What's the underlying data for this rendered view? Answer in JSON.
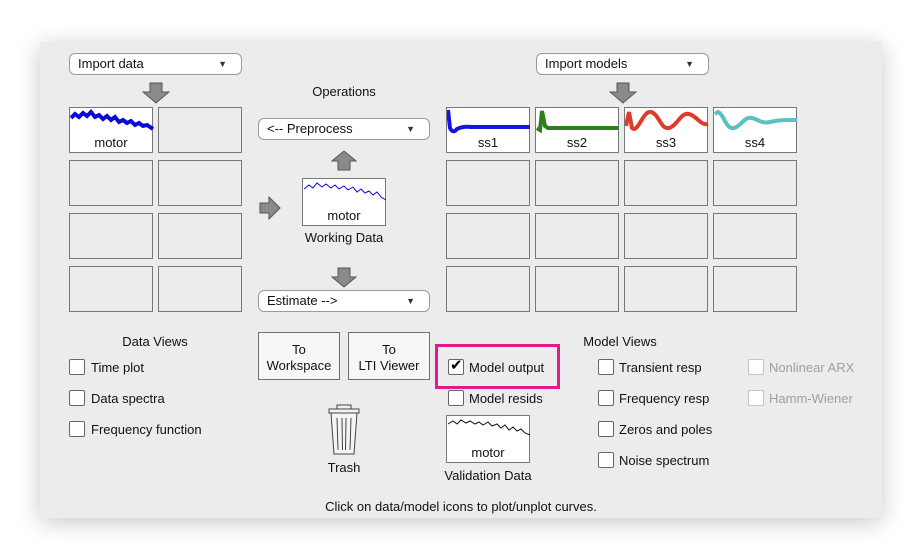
{
  "data_panel": {
    "import_label": "Import data",
    "slot1_label": "motor"
  },
  "operations": {
    "title": "Operations",
    "preprocess_label": "<-- Preprocess",
    "working_data_label": "motor",
    "working_data_caption": "Working Data",
    "estimate_label": "Estimate -->"
  },
  "model_panel": {
    "import_label": "Import models",
    "models": [
      {
        "label": "ss1",
        "color": "#1414e6"
      },
      {
        "label": "ss2",
        "color": "#2e7d1e"
      },
      {
        "label": "ss3",
        "color": "#e03a2c"
      },
      {
        "label": "ss4",
        "color": "#5ac0c4"
      }
    ]
  },
  "data_views": {
    "title": "Data Views",
    "items": [
      {
        "label": "Time plot",
        "checked": false
      },
      {
        "label": "Data spectra",
        "checked": false
      },
      {
        "label": "Frequency function",
        "checked": false
      }
    ]
  },
  "buttons": {
    "to_workspace": [
      "To",
      "Workspace"
    ],
    "to_lti": [
      "To",
      "LTI Viewer"
    ]
  },
  "center_checks": {
    "model_output": {
      "label": "Model output",
      "checked": true,
      "highlight": "#e6198c"
    },
    "model_resids": {
      "label": "Model resids",
      "checked": false
    }
  },
  "trash_label": "Trash",
  "validation": {
    "label": "motor",
    "caption": "Validation Data"
  },
  "model_views": {
    "title": "Model Views",
    "items": [
      {
        "label": "Transient resp",
        "checked": false
      },
      {
        "label": "Frequency resp",
        "checked": false
      },
      {
        "label": "Zeros and poles",
        "checked": false
      },
      {
        "label": "Noise spectrum",
        "checked": false
      }
    ],
    "disabled_items": [
      {
        "label": "Nonlinear ARX"
      },
      {
        "label": "Hamm-Wiener"
      }
    ]
  },
  "status_text": "Click on data/model icons to plot/unplot curves."
}
